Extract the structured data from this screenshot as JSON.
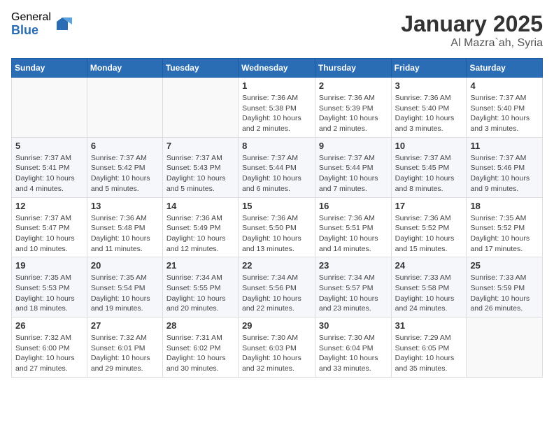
{
  "header": {
    "logo_general": "General",
    "logo_blue": "Blue",
    "title": "January 2025",
    "subtitle": "Al Mazra`ah, Syria"
  },
  "weekdays": [
    "Sunday",
    "Monday",
    "Tuesday",
    "Wednesday",
    "Thursday",
    "Friday",
    "Saturday"
  ],
  "weeks": [
    [
      {
        "day": "",
        "info": ""
      },
      {
        "day": "",
        "info": ""
      },
      {
        "day": "",
        "info": ""
      },
      {
        "day": "1",
        "info": "Sunrise: 7:36 AM\nSunset: 5:38 PM\nDaylight: 10 hours\nand 2 minutes."
      },
      {
        "day": "2",
        "info": "Sunrise: 7:36 AM\nSunset: 5:39 PM\nDaylight: 10 hours\nand 2 minutes."
      },
      {
        "day": "3",
        "info": "Sunrise: 7:36 AM\nSunset: 5:40 PM\nDaylight: 10 hours\nand 3 minutes."
      },
      {
        "day": "4",
        "info": "Sunrise: 7:37 AM\nSunset: 5:40 PM\nDaylight: 10 hours\nand 3 minutes."
      }
    ],
    [
      {
        "day": "5",
        "info": "Sunrise: 7:37 AM\nSunset: 5:41 PM\nDaylight: 10 hours\nand 4 minutes."
      },
      {
        "day": "6",
        "info": "Sunrise: 7:37 AM\nSunset: 5:42 PM\nDaylight: 10 hours\nand 5 minutes."
      },
      {
        "day": "7",
        "info": "Sunrise: 7:37 AM\nSunset: 5:43 PM\nDaylight: 10 hours\nand 5 minutes."
      },
      {
        "day": "8",
        "info": "Sunrise: 7:37 AM\nSunset: 5:44 PM\nDaylight: 10 hours\nand 6 minutes."
      },
      {
        "day": "9",
        "info": "Sunrise: 7:37 AM\nSunset: 5:44 PM\nDaylight: 10 hours\nand 7 minutes."
      },
      {
        "day": "10",
        "info": "Sunrise: 7:37 AM\nSunset: 5:45 PM\nDaylight: 10 hours\nand 8 minutes."
      },
      {
        "day": "11",
        "info": "Sunrise: 7:37 AM\nSunset: 5:46 PM\nDaylight: 10 hours\nand 9 minutes."
      }
    ],
    [
      {
        "day": "12",
        "info": "Sunrise: 7:37 AM\nSunset: 5:47 PM\nDaylight: 10 hours\nand 10 minutes."
      },
      {
        "day": "13",
        "info": "Sunrise: 7:36 AM\nSunset: 5:48 PM\nDaylight: 10 hours\nand 11 minutes."
      },
      {
        "day": "14",
        "info": "Sunrise: 7:36 AM\nSunset: 5:49 PM\nDaylight: 10 hours\nand 12 minutes."
      },
      {
        "day": "15",
        "info": "Sunrise: 7:36 AM\nSunset: 5:50 PM\nDaylight: 10 hours\nand 13 minutes."
      },
      {
        "day": "16",
        "info": "Sunrise: 7:36 AM\nSunset: 5:51 PM\nDaylight: 10 hours\nand 14 minutes."
      },
      {
        "day": "17",
        "info": "Sunrise: 7:36 AM\nSunset: 5:52 PM\nDaylight: 10 hours\nand 15 minutes."
      },
      {
        "day": "18",
        "info": "Sunrise: 7:35 AM\nSunset: 5:52 PM\nDaylight: 10 hours\nand 17 minutes."
      }
    ],
    [
      {
        "day": "19",
        "info": "Sunrise: 7:35 AM\nSunset: 5:53 PM\nDaylight: 10 hours\nand 18 minutes."
      },
      {
        "day": "20",
        "info": "Sunrise: 7:35 AM\nSunset: 5:54 PM\nDaylight: 10 hours\nand 19 minutes."
      },
      {
        "day": "21",
        "info": "Sunrise: 7:34 AM\nSunset: 5:55 PM\nDaylight: 10 hours\nand 20 minutes."
      },
      {
        "day": "22",
        "info": "Sunrise: 7:34 AM\nSunset: 5:56 PM\nDaylight: 10 hours\nand 22 minutes."
      },
      {
        "day": "23",
        "info": "Sunrise: 7:34 AM\nSunset: 5:57 PM\nDaylight: 10 hours\nand 23 minutes."
      },
      {
        "day": "24",
        "info": "Sunrise: 7:33 AM\nSunset: 5:58 PM\nDaylight: 10 hours\nand 24 minutes."
      },
      {
        "day": "25",
        "info": "Sunrise: 7:33 AM\nSunset: 5:59 PM\nDaylight: 10 hours\nand 26 minutes."
      }
    ],
    [
      {
        "day": "26",
        "info": "Sunrise: 7:32 AM\nSunset: 6:00 PM\nDaylight: 10 hours\nand 27 minutes."
      },
      {
        "day": "27",
        "info": "Sunrise: 7:32 AM\nSunset: 6:01 PM\nDaylight: 10 hours\nand 29 minutes."
      },
      {
        "day": "28",
        "info": "Sunrise: 7:31 AM\nSunset: 6:02 PM\nDaylight: 10 hours\nand 30 minutes."
      },
      {
        "day": "29",
        "info": "Sunrise: 7:30 AM\nSunset: 6:03 PM\nDaylight: 10 hours\nand 32 minutes."
      },
      {
        "day": "30",
        "info": "Sunrise: 7:30 AM\nSunset: 6:04 PM\nDaylight: 10 hours\nand 33 minutes."
      },
      {
        "day": "31",
        "info": "Sunrise: 7:29 AM\nSunset: 6:05 PM\nDaylight: 10 hours\nand 35 minutes."
      },
      {
        "day": "",
        "info": ""
      }
    ]
  ]
}
